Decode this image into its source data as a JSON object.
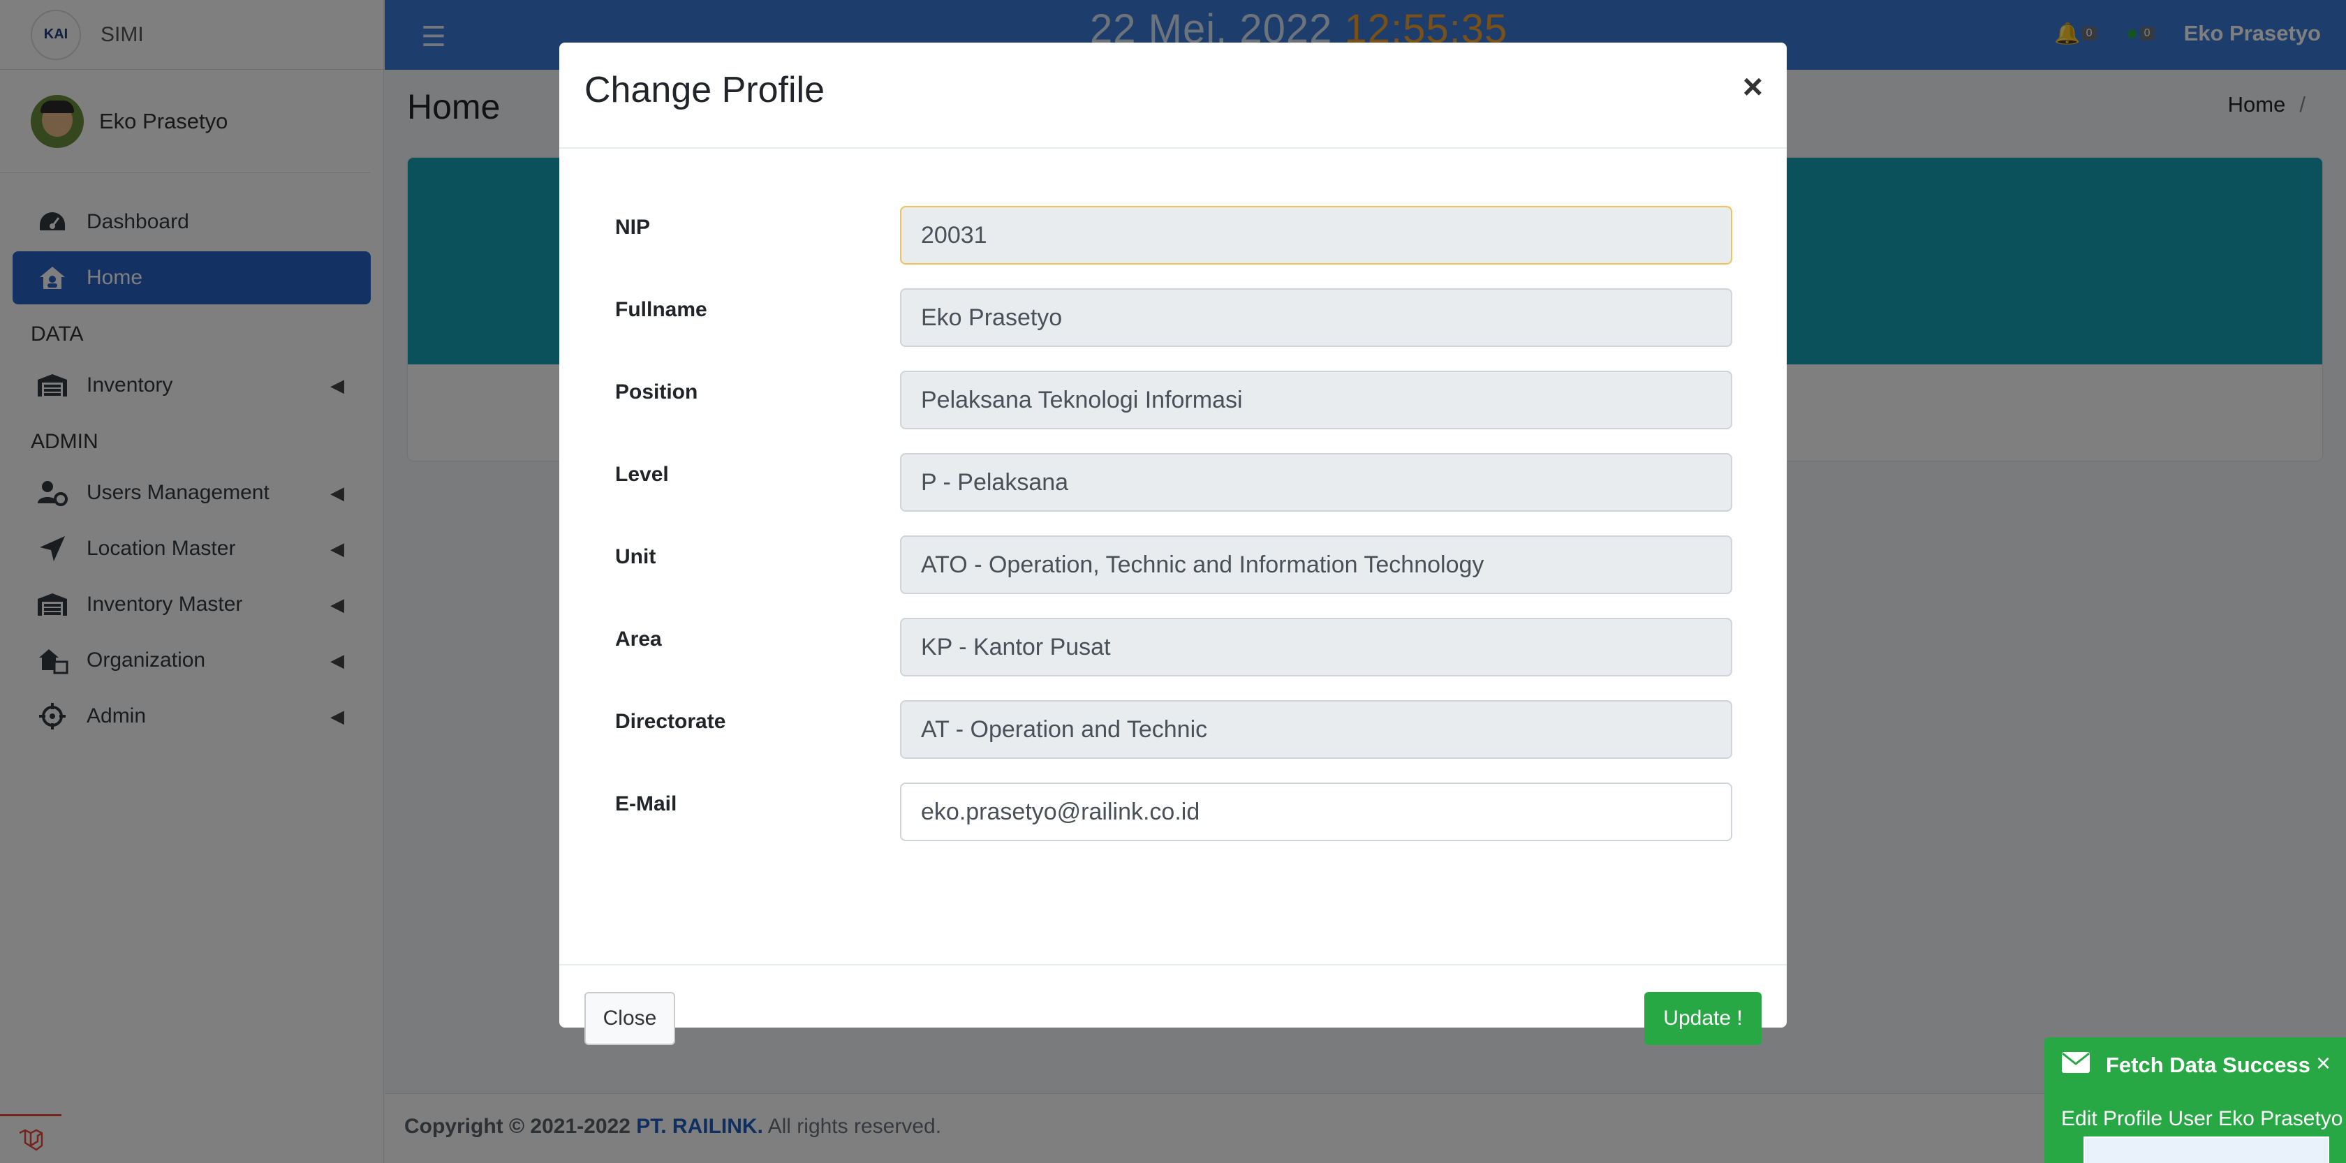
{
  "app": {
    "name": "SIMI",
    "logo_text": "KAI"
  },
  "sidebar": {
    "user_name": "Eko Prasetyo",
    "items": [
      {
        "label": "Dashboard"
      },
      {
        "label": "Home",
        "active": true
      },
      {
        "header": "DATA"
      },
      {
        "label": "Inventory"
      },
      {
        "header": "ADMIN"
      },
      {
        "label": "Users Management"
      },
      {
        "label": "Location Master"
      },
      {
        "label": "Inventory Master"
      },
      {
        "label": "Organization"
      },
      {
        "label": "Admin"
      }
    ]
  },
  "topbar": {
    "date": "22 Mei, 2022",
    "time": "12:55:35",
    "notif_count": "0",
    "msg_count": "0",
    "user_name": "Eko Prasetyo"
  },
  "page": {
    "title": "Home",
    "breadcrumb": "Home",
    "breadcrumb_sep": "/"
  },
  "modal": {
    "title": "Change Profile",
    "close_x": "×",
    "fields": {
      "nip": {
        "label": "NIP",
        "value": "20031"
      },
      "fullname": {
        "label": "Fullname",
        "value": "Eko Prasetyo"
      },
      "position": {
        "label": "Position",
        "value": "Pelaksana Teknologi Informasi"
      },
      "level": {
        "label": "Level",
        "value": "P - Pelaksana"
      },
      "unit": {
        "label": "Unit",
        "value": "ATO - Operation, Technic and Information Technology"
      },
      "area": {
        "label": "Area",
        "value": "KP - Kantor Pusat"
      },
      "directorate": {
        "label": "Directorate",
        "value": "AT - Operation and Technic"
      },
      "email": {
        "label": "E-Mail",
        "value": "eko.prasetyo@railink.co.id"
      }
    },
    "close_label": "Close",
    "update_label": "Update !"
  },
  "footer": {
    "copyright": "Copyright © 2021-2022",
    "company": "PT. RAILINK.",
    "rights": "All rights reserved."
  },
  "toast": {
    "title": "Fetch Data Success",
    "body": "Edit Profile User Eko Prasetyo",
    "close": "×"
  },
  "colors": {
    "primary": "#3b7dd8",
    "sidebar_active": "#2962c9",
    "success": "#28a745",
    "info": "#17a2b8",
    "clock_time": "#f0a030"
  }
}
